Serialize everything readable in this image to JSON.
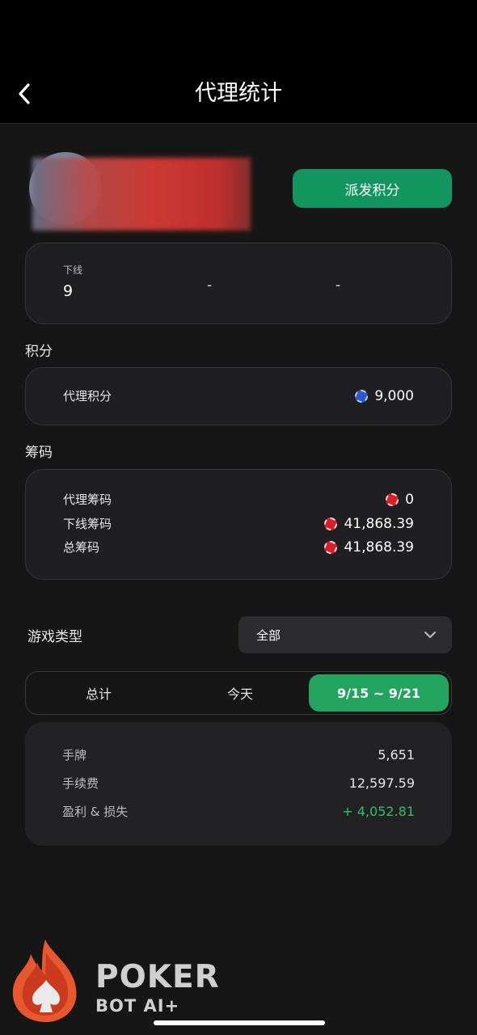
{
  "header": {
    "title": "代理统计"
  },
  "profile": {
    "dispatch_button": "派发积分"
  },
  "downline_card": {
    "label": "下线",
    "value": "9",
    "dash_1": "-",
    "dash_2": "-"
  },
  "points_section": {
    "label": "积分",
    "rows": [
      {
        "label": "代理积分",
        "value": "9,000",
        "icon": "blue-chip-icon"
      }
    ]
  },
  "chips_section": {
    "label": "筹码",
    "rows": [
      {
        "label": "代理筹码",
        "value": "0",
        "icon": "red-chip-icon"
      },
      {
        "label": "下线筹码",
        "value": "41,868.39",
        "icon": "red-chip-icon"
      },
      {
        "label": "总筹码",
        "value": "41,868.39",
        "icon": "red-chip-icon"
      }
    ]
  },
  "game_type": {
    "label": "游戏类型",
    "selected": "全部"
  },
  "tabs": [
    {
      "label": "总计",
      "active": false
    },
    {
      "label": "今天",
      "active": false
    },
    {
      "label": "9/15 ~ 9/21",
      "active": true
    }
  ],
  "stats": [
    {
      "label": "手牌",
      "value": "5,651"
    },
    {
      "label": "手续费",
      "value": "12,597.59"
    },
    {
      "label": "盈利 & 损失",
      "value": "+ 4,052.81",
      "color": "#2fbe6e"
    }
  ],
  "watermark": {
    "line1": "POKER",
    "line2": "BOT AI+"
  },
  "colors": {
    "accent_green": "#13955f",
    "tab_active": "#22a35e",
    "profit": "#2fbe6e"
  }
}
